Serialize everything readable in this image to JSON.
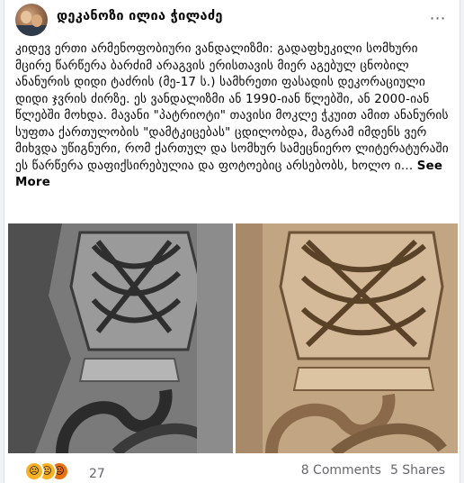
{
  "post": {
    "author": "დეკანოზი ილია ჭილაძე",
    "text": "კიდევ ერთი არმენოფობიური ვანდალიზმი: გადაფხეკილი სომხური მცირე წარწერა ბარძიმ არაგვის ერისთავის მიერ აგებულ ცნობილ ანანურის დიდი ტაძრის (მე-17 ს.) სამხრეთი ფასადის დეკორაციული დიდი ჯვრის ძირზე. ეს ვანდალიზმი ან 1990-იან წლებში, ან 2000-იან წლებში მოხდა. მავანი \"პატრიოტი\" თავისი მოკლე ჭკუით ამით ანანურის სუფთა ქართულობის \"დამტკიცებას\" ცდილობდა, მაგრამ იმდენს ვერ მიხვდა უწიგნური, რომ ქართულ და სომხურ სამეცნიერო ლიტერატურაში ეს წარწერა დაფიქსირებულია და ფოტოებიც არსებობს, ხოლო ი...",
    "see_more": "See More",
    "more_icon": "⋯"
  },
  "photos": {
    "left_name": "archival-bw-photo",
    "right_name": "current-color-photo"
  },
  "footer": {
    "reaction_count": "27",
    "comments": "8 Comments",
    "shares": "5 Shares"
  },
  "colors": {
    "sad_reaction": "#f7b125",
    "angry_reaction": "#e9710f",
    "secondary_text": "#65676b"
  }
}
